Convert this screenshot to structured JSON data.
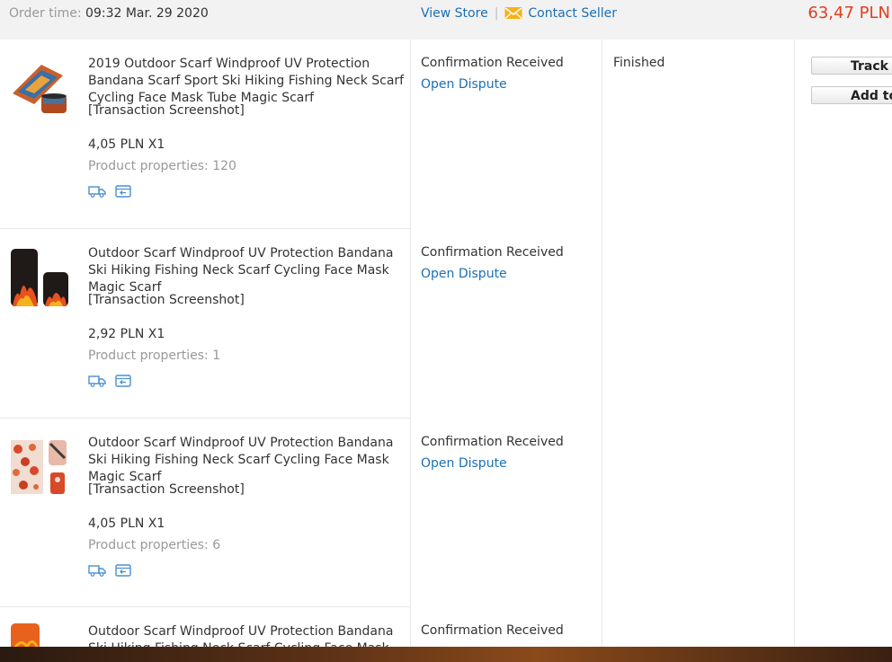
{
  "order": {
    "time_label": "Order time:",
    "time_value": "09:32 Mar. 29 2020",
    "view_store": "View Store",
    "separator": "|",
    "contact_seller": "Contact Seller",
    "total": "63,47 PLN",
    "order_status": "Finished"
  },
  "actions": {
    "track": "Track Order",
    "add_to_cart": "Add to Cart"
  },
  "items": [
    {
      "title": "2019 Outdoor Scarf Windproof UV Protection Bandana Scarf Sport Ski Hiking Fishing Neck Scarf Cycling Face Mask Tube Magic Scarf",
      "screenshot": "[Transaction Screenshot]",
      "price": "4,05 PLN X1",
      "props_label": "Product properties:",
      "props_value": "120",
      "status": "Confirmation Received",
      "dispute": "Open Dispute"
    },
    {
      "title": "Outdoor Scarf Windproof UV Protection Bandana Ski Hiking Fishing Neck Scarf Cycling Face Mask Magic Scarf",
      "screenshot": "[Transaction Screenshot]",
      "price": "2,92 PLN X1",
      "props_label": "Product properties:",
      "props_value": "1",
      "status": "Confirmation Received",
      "dispute": "Open Dispute"
    },
    {
      "title": "Outdoor Scarf Windproof UV Protection Bandana Ski Hiking Fishing Neck Scarf Cycling Face Mask Magic Scarf",
      "screenshot": "[Transaction Screenshot]",
      "price": "4,05 PLN X1",
      "props_label": "Product properties:",
      "props_value": "6",
      "status": "Confirmation Received",
      "dispute": "Open Dispute"
    },
    {
      "title": "Outdoor Scarf Windproof UV Protection Bandana Ski Hiking Fishing Neck Scarf Cycling Face Mask Magic Scarf",
      "status": "Confirmation Received"
    }
  ],
  "icons": {
    "contact": "envelope-icon",
    "shipping": "delivery-truck-icon",
    "return": "return-box-icon"
  },
  "colors": {
    "link": "#1a6fb5",
    "price_total": "#e0401f",
    "header_bg": "#f2f2f2",
    "muted_text": "#999999",
    "mini_icon": "#4a8fd4",
    "mail_icon": "#f5b21a"
  }
}
